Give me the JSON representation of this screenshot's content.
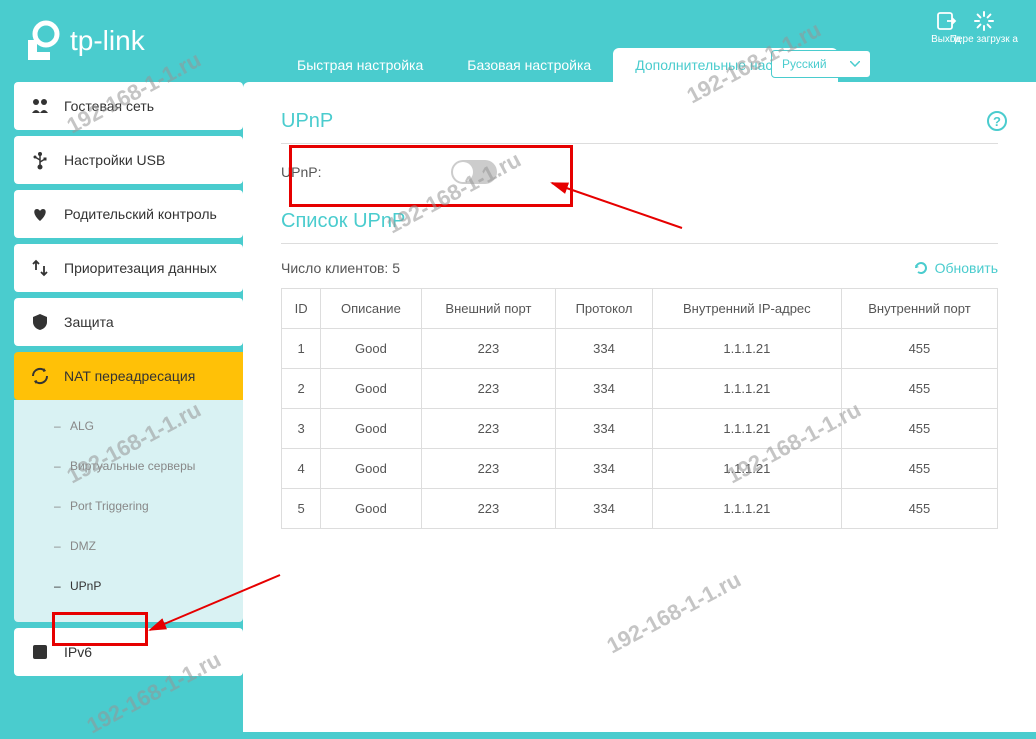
{
  "brand": "tp-link",
  "header": {
    "tabs": [
      "Быстрая настройка",
      "Базовая настройка",
      "Дополнительные настройки"
    ],
    "active_tab": 2,
    "language": "Русский",
    "exit_label": "Выход",
    "reload_label": "Пере загрузк а"
  },
  "sidebar": {
    "items": [
      {
        "label": "Гостевая сеть",
        "icon": "people"
      },
      {
        "label": "Настройки USB",
        "icon": "usb"
      },
      {
        "label": "Родительский контроль",
        "icon": "heart"
      },
      {
        "label": "Приоритезация данных",
        "icon": "priority"
      },
      {
        "label": "Защита",
        "icon": "shield"
      },
      {
        "label": "NAT переадресация",
        "icon": "nat",
        "active": true
      },
      {
        "label": "IPv6",
        "icon": "ipv6"
      }
    ],
    "submenu": [
      "ALG",
      "Виртуальные серверы",
      "Port Triggering",
      "DMZ",
      "UPnP"
    ],
    "submenu_selected": 4
  },
  "content": {
    "section_title": "UPnP",
    "toggle_label": "UPnP:",
    "list_title": "Список UPnP",
    "clients_label": "Число клиентов:",
    "clients_count": "5",
    "refresh_label": "Обновить",
    "table": {
      "headers": [
        "ID",
        "Описание",
        "Внешний порт",
        "Протокол",
        "Внутренний IP-адрес",
        "Внутренний порт"
      ],
      "rows": [
        [
          "1",
          "Good",
          "223",
          "334",
          "1.1.1.21",
          "455"
        ],
        [
          "2",
          "Good",
          "223",
          "334",
          "1.1.1.21",
          "455"
        ],
        [
          "3",
          "Good",
          "223",
          "334",
          "1.1.1.21",
          "455"
        ],
        [
          "4",
          "Good",
          "223",
          "334",
          "1.1.1.21",
          "455"
        ],
        [
          "5",
          "Good",
          "223",
          "334",
          "1.1.1.21",
          "455"
        ]
      ]
    }
  },
  "watermark": "192-168-1-1.ru"
}
